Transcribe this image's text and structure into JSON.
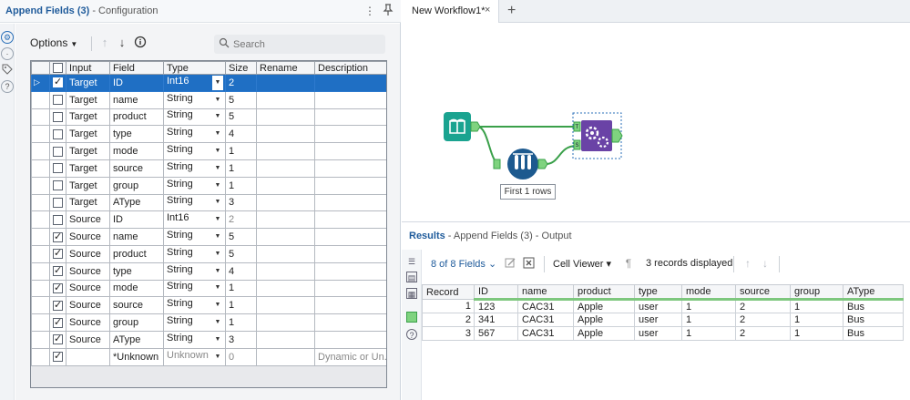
{
  "config": {
    "title": "Append Fields (3)",
    "subtitle": " - Configuration",
    "options_label": "Options",
    "search_placeholder": "Search",
    "columns": [
      "Input",
      "Field",
      "Type",
      "Size",
      "Rename",
      "Description"
    ],
    "rows": [
      {
        "checked": true,
        "input": "Target",
        "field": "ID",
        "type": "Int16",
        "size": "2",
        "rename": "",
        "description": "",
        "selected": true
      },
      {
        "checked": false,
        "input": "Target",
        "field": "name",
        "type": "String",
        "size": "5",
        "rename": "",
        "description": ""
      },
      {
        "checked": false,
        "input": "Target",
        "field": "product",
        "type": "String",
        "size": "5",
        "rename": "",
        "description": ""
      },
      {
        "checked": false,
        "input": "Target",
        "field": "type",
        "type": "String",
        "size": "4",
        "rename": "",
        "description": ""
      },
      {
        "checked": false,
        "input": "Target",
        "field": "mode",
        "type": "String",
        "size": "1",
        "rename": "",
        "description": ""
      },
      {
        "checked": false,
        "input": "Target",
        "field": "source",
        "type": "String",
        "size": "1",
        "rename": "",
        "description": ""
      },
      {
        "checked": false,
        "input": "Target",
        "field": "group",
        "type": "String",
        "size": "1",
        "rename": "",
        "description": ""
      },
      {
        "checked": false,
        "input": "Target",
        "field": "AType",
        "type": "String",
        "size": "3",
        "rename": "",
        "description": ""
      },
      {
        "checked": false,
        "input": "Source",
        "field": "ID",
        "type": "Int16",
        "size": "2",
        "rename": "",
        "description": "",
        "greysize": true
      },
      {
        "checked": true,
        "input": "Source",
        "field": "name",
        "type": "String",
        "size": "5",
        "rename": "",
        "description": ""
      },
      {
        "checked": true,
        "input": "Source",
        "field": "product",
        "type": "String",
        "size": "5",
        "rename": "",
        "description": ""
      },
      {
        "checked": true,
        "input": "Source",
        "field": "type",
        "type": "String",
        "size": "4",
        "rename": "",
        "description": ""
      },
      {
        "checked": true,
        "input": "Source",
        "field": "mode",
        "type": "String",
        "size": "1",
        "rename": "",
        "description": ""
      },
      {
        "checked": true,
        "input": "Source",
        "field": "source",
        "type": "String",
        "size": "1",
        "rename": "",
        "description": ""
      },
      {
        "checked": true,
        "input": "Source",
        "field": "group",
        "type": "String",
        "size": "1",
        "rename": "",
        "description": ""
      },
      {
        "checked": true,
        "input": "Source",
        "field": "AType",
        "type": "String",
        "size": "3",
        "rename": "",
        "description": ""
      },
      {
        "checked": true,
        "input": "",
        "field": "*Unknown",
        "type": "Unknown",
        "size": "0",
        "rename": "",
        "description": "Dynamic or Un...",
        "unknown": true
      }
    ]
  },
  "workflow": {
    "tab_label": "New Workflow1*",
    "tab_close": "×",
    "tab_add": "+",
    "browse_label": "First 1 rows",
    "anchors": {
      "target": "T",
      "source": "S"
    }
  },
  "results": {
    "title": "Results",
    "subtitle": " - Append Fields (3) - Output",
    "fields_label": "8 of 8 Fields",
    "viewer_label": "Cell Viewer",
    "records_label": "3 records displayed",
    "columns": [
      "Record",
      "ID",
      "name",
      "product",
      "type",
      "mode",
      "source",
      "group",
      "AType"
    ],
    "rows": [
      [
        "1",
        "123",
        "CAC31",
        "Apple",
        "user",
        "1",
        "2",
        "1",
        "Bus"
      ],
      [
        "2",
        "341",
        "CAC31",
        "Apple",
        "user",
        "1",
        "2",
        "1",
        "Bus"
      ],
      [
        "3",
        "567",
        "CAC31",
        "Apple",
        "user",
        "1",
        "2",
        "1",
        "Bus"
      ]
    ]
  },
  "colors": {
    "accent": "#1f6fc4",
    "input_tool": "#1aa390",
    "sample_tool": "#1d5a8f",
    "append_tool": "#6a43a6",
    "connection": "#3aa04a"
  }
}
